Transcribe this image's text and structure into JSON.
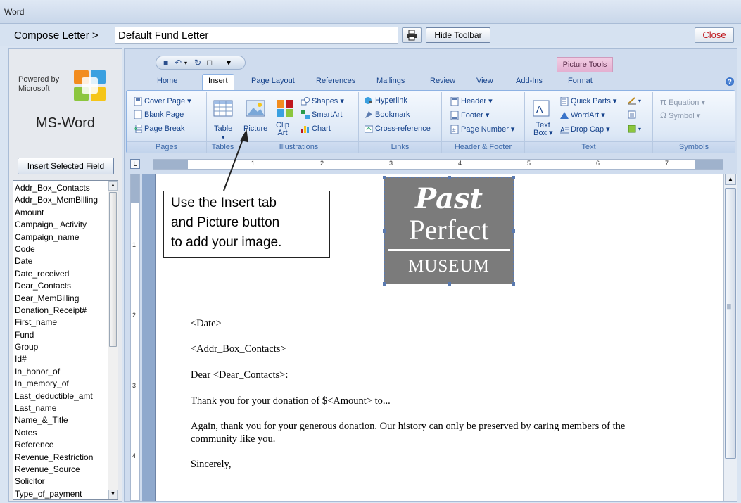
{
  "window": {
    "title": "Word"
  },
  "compose": {
    "label": "Compose Letter >",
    "letter_name": "Default Fund Letter",
    "hide_toolbar": "Hide Toolbar",
    "close": "Close"
  },
  "left_panel": {
    "powered_by_line1": "Powered by",
    "powered_by_line2": "Microsoft",
    "app_name": "MS-Word",
    "insert_field_button": "Insert Selected Field",
    "fields": [
      "Addr_Box_Contacts",
      "Addr_Box_MemBilling",
      "Amount",
      "Campaign_ Activity",
      "Campaign_name",
      "Code",
      "Date",
      "Date_received",
      "Dear_Contacts",
      "Dear_MemBilling",
      "Donation_Receipt#",
      "First_name",
      "Fund",
      "Group",
      "Id#",
      "In_honor_of",
      "In_memory_of",
      "Last_deductible_amt",
      "Last_name",
      "Name_&_Title",
      "Notes",
      "Reference",
      "Revenue_Restriction",
      "Revenue_Source",
      "Solicitor",
      "Type_of_payment"
    ]
  },
  "ribbon": {
    "contextual_header": "Picture Tools",
    "tabs": [
      "Home",
      "Insert",
      "Page Layout",
      "References",
      "Mailings",
      "Review",
      "View",
      "Add-Ins",
      "Format"
    ],
    "active_tab": "Insert",
    "groups": {
      "pages": {
        "label": "Pages",
        "items": [
          "Cover Page ▾",
          "Blank Page",
          "Page Break"
        ]
      },
      "tables": {
        "label": "Tables",
        "items": [
          "Table"
        ]
      },
      "illustrations": {
        "label": "Illustrations",
        "items": [
          "Picture",
          "Clip",
          "Art",
          "Shapes ▾",
          "SmartArt",
          "Chart"
        ]
      },
      "links": {
        "label": "Links",
        "items": [
          "Hyperlink",
          "Bookmark",
          "Cross-reference"
        ]
      },
      "header_footer": {
        "label": "Header & Footer",
        "items": [
          "Header ▾",
          "Footer ▾",
          "Page Number ▾"
        ]
      },
      "text": {
        "label": "Text",
        "items": [
          "Text",
          "Box ▾",
          "Quick Parts ▾",
          "WordArt ▾",
          "Drop Cap ▾"
        ]
      },
      "symbols": {
        "label": "Symbols",
        "items": [
          "Equation ▾",
          "Symbol ▾"
        ]
      }
    }
  },
  "ruler": {
    "numbers": [
      "1",
      "2",
      "3",
      "4",
      "5",
      "6",
      "7"
    ],
    "v_numbers": [
      "1",
      "2",
      "3",
      "4"
    ]
  },
  "logo": {
    "line1": "Past",
    "line2": "Perfect",
    "line3": "MUSEUM"
  },
  "letter": {
    "date": "<Date>",
    "address": "<Addr_Box_Contacts>",
    "salutation": "Dear <Dear_Contacts>:",
    "para1": "Thank you for your donation of $<Amount> to...",
    "para2_line1": "Again, thank you for your generous donation.  Our history can only be preserved by caring members of the",
    "para2_line2": "community like you.",
    "closing": "Sincerely,"
  },
  "callout": {
    "line1": "Use the Insert tab",
    "line2": "and Picture button",
    "line3": "to add your image."
  },
  "colors": {
    "accent": "#15428b",
    "close": "#c0181e",
    "picture_tools": "#e3aed0"
  }
}
